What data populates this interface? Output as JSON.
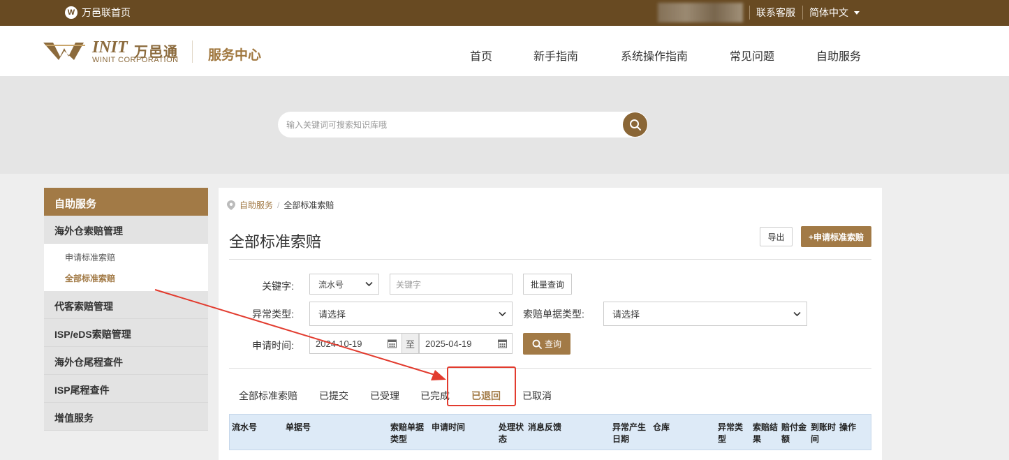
{
  "topbar": {
    "home_label": "万邑联首页",
    "home_icon": "W",
    "contact": "联系客服",
    "language": "简体中文"
  },
  "header": {
    "brand_int": "INIT",
    "brand_cn": "万邑通",
    "brand_en": "WINIT CORPORATION",
    "section_title": "服务中心",
    "nav": [
      "首页",
      "新手指南",
      "系统操作指南",
      "常见问题",
      "自助服务"
    ]
  },
  "search": {
    "placeholder": "输入关键词可搜索知识库哦"
  },
  "sidebar": {
    "head": "自助服务",
    "group1": "海外仓索赔管理",
    "sub_items": [
      "申请标准索赔",
      "全部标准索赔"
    ],
    "groups": [
      "代客索赔管理",
      "ISP/eDS索赔管理",
      "海外仓尾程查件",
      "ISP尾程查件",
      "增值服务"
    ]
  },
  "breadcrumb": {
    "parent": "自助服务",
    "current": "全部标准索赔"
  },
  "page": {
    "title": "全部标准索赔",
    "export_button": "导出",
    "add_button": "+申请标准索赔"
  },
  "filters": {
    "keyword_label": "关键字:",
    "keyword_type": "流水号",
    "keyword_placeholder": "关键字",
    "batch_button": "批量查询",
    "exception_label": "异常类型:",
    "exception_value": "请选择",
    "doc_type_label": "索赔单据类型:",
    "doc_type_value": "请选择",
    "date_label": "申请时间:",
    "date_from": "2024-10-19",
    "date_to_sep": "至",
    "date_to": "2025-04-19",
    "query_button": "查询"
  },
  "tabs": [
    "全部标准索赔",
    "已提交",
    "已受理",
    "已完成",
    "已退回",
    "已取消"
  ],
  "active_tab": "已退回",
  "table": {
    "headers": [
      "流水号",
      "单据号",
      "索赔单据\n类型",
      "申请时间",
      "处理状\n态",
      "消息反馈",
      "异常产生\n日期",
      "仓库",
      "异常类\n型",
      "索赔结\n果",
      "赔付金\n额",
      "到账时\n间",
      "操作"
    ]
  },
  "colors": {
    "topbar": "#684a22",
    "accent": "#a27a46",
    "annotation": "#e23b2e",
    "table_header": "#ddeaf7"
  }
}
